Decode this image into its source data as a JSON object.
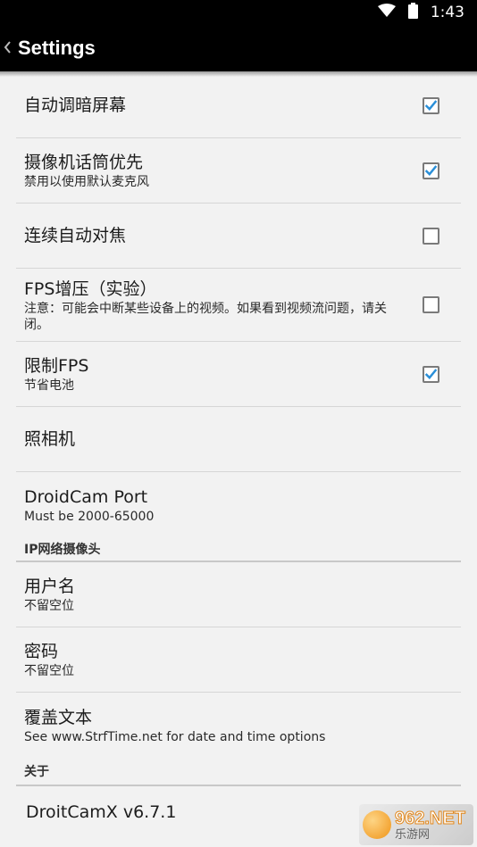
{
  "status": {
    "time": "1:43"
  },
  "app_bar": {
    "title": "Settings"
  },
  "settings": [
    {
      "title": "自动调暗屏幕",
      "subtitle": "",
      "checked": true
    },
    {
      "title": "摄像机话筒优先",
      "subtitle": "禁用以使用默认麦克风",
      "checked": true
    },
    {
      "title": "连续自动对焦",
      "subtitle": "",
      "checked": false
    },
    {
      "title": "FPS增压（实验）",
      "subtitle": "注意：可能会中断某些设备上的视频。如果看到视频流问题，请关闭。",
      "checked": false
    },
    {
      "title": "限制FPS",
      "subtitle": "节省电池",
      "checked": true
    },
    {
      "title": "照相机",
      "subtitle": ""
    },
    {
      "title": "DroidCam Port",
      "subtitle": "Must be 2000-65000"
    }
  ],
  "ip_section": {
    "header": "IP网络摄像头",
    "items": [
      {
        "title": "用户名",
        "subtitle": "不留空位"
      },
      {
        "title": "密码",
        "subtitle": "不留空位"
      },
      {
        "title": "覆盖文本",
        "subtitle": "See www.StrfTime.net for date and time options"
      }
    ]
  },
  "about_section": {
    "header": "关于",
    "items": [
      {
        "title": "DroitCamX v6.7.1"
      }
    ]
  },
  "watermark": {
    "top": "962.NET",
    "bottom": "乐游网"
  },
  "colors": {
    "checkmark": "#2a8fd8",
    "accent_bar": "#000000"
  }
}
